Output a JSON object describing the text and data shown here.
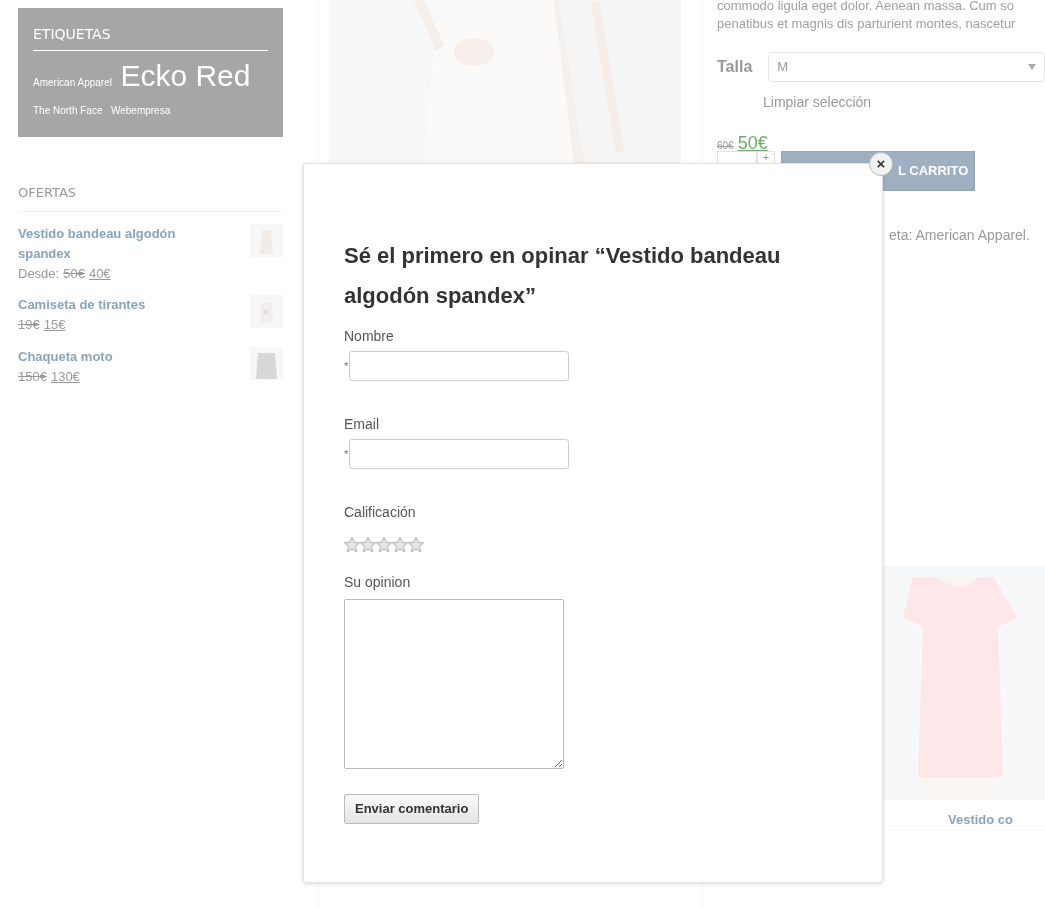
{
  "sidebar": {
    "tags_widget": {
      "title": "ETIQUETAS",
      "tags": [
        {
          "label": "American Apparel",
          "kind": "small"
        },
        {
          "label": "Ecko Red",
          "kind": "large"
        },
        {
          "label": "The North Face",
          "kind": "small"
        },
        {
          "label": "Webempresa",
          "kind": "small"
        }
      ]
    },
    "offers_widget": {
      "title": "OFERTAS",
      "items": [
        {
          "name": "Vestido bandeau algodón spandex",
          "prefix": "Desde:",
          "old_price": "50€",
          "price": "40€",
          "kind": "dress"
        },
        {
          "name": "Camiseta de tirantes",
          "old_price": "19€",
          "price": "15€",
          "kind": "top"
        },
        {
          "name": "Chaqueta moto",
          "old_price": "150€",
          "price": "130€",
          "kind": "jacket"
        }
      ]
    }
  },
  "product": {
    "description_lines": [
      "commodo ligula eget dolor. Aenean massa. Cum so",
      "penatibus et magnis dis parturient montes, nascetur"
    ],
    "attribute_label": "Talla",
    "attribute_value": "M",
    "clear_link": "Limpiar selección",
    "old_price": "60€",
    "price": "50€",
    "quantity_plus": "+",
    "cart_button": "L CARRITO",
    "meta": "eta: American Apparel."
  },
  "related": {
    "items": [
      {
        "name": "Vestido co"
      }
    ]
  },
  "review_modal": {
    "close": "×",
    "title": "Sé el primero en opinar “Vestido bandeau algodón spandex”",
    "fields": [
      {
        "kind": "input",
        "label": "Nombre",
        "required_mark": "*"
      },
      {
        "kind": "input",
        "label": "Email",
        "required_mark": "*"
      },
      {
        "kind": "rating",
        "label": "Calificación",
        "stars": 0
      },
      {
        "kind": "textarea",
        "label": "Su opinion"
      }
    ],
    "submit": "Enviar comentario"
  }
}
